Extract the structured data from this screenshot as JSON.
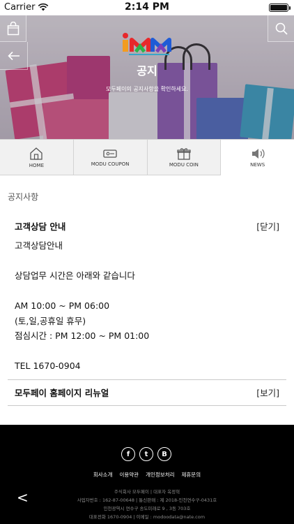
{
  "status_bar": {
    "carrier": "Carrier",
    "time": "2:14 PM"
  },
  "header": {
    "logo_alt": "iMM",
    "title": "공지",
    "subtitle": "모두페이의 공지사항을 확인하세요.",
    "icons": {
      "bag": "shopping-bag-icon",
      "search": "search-icon",
      "back": "arrow-left-icon"
    }
  },
  "tabs": [
    {
      "label": "HOME",
      "icon": "home-icon",
      "active": false
    },
    {
      "label": "MODU COUPON",
      "icon": "coupon-icon",
      "active": false
    },
    {
      "label": "MODU COIN",
      "icon": "gift-icon",
      "active": false
    },
    {
      "label": "NEWS",
      "icon": "speaker-icon",
      "active": true
    }
  ],
  "section_title": "공지사항",
  "notices": [
    {
      "title": "고객상담 안내",
      "toggle": "[닫기]",
      "expanded": true,
      "body": [
        "고객상담안내",
        "",
        "상담업무 시간은 아래와 같습니다",
        "",
        "AM 10:00 ~ PM 06:00",
        "(토,일,공휴일 휴무)",
        "점심시간 : PM 12:00 ~ PM 01:00",
        "",
        "TEL 1670-0904"
      ]
    },
    {
      "title": "모두페이 홈페이지 리뉴얼",
      "toggle": "[보기]",
      "expanded": false,
      "body": []
    }
  ],
  "footer": {
    "social": [
      {
        "label": "f",
        "icon": "facebook-icon"
      },
      {
        "label": "t",
        "icon": "twitter-icon"
      },
      {
        "label": "B",
        "icon": "blog-icon"
      }
    ],
    "links": [
      "회사소개",
      "이용약관",
      "개인정보처리",
      "제휴문의"
    ],
    "info": [
      "주식회사 모두페이 | 대표자 옥정혁",
      "사업자번호 : 162-87-00648 | 통신판매 : 제 2018-인천연수구-0431호",
      "인천광역시 연수구 송도미래로 9 , 3동 703호",
      "대표전화 1670-0904 | 이메일 : modoodata@nate.com"
    ],
    "back_label": "<"
  },
  "colors": {
    "footer_bg": "#000000",
    "tab_bg": "#f1f1f1",
    "divider": "#c9c9c9"
  }
}
